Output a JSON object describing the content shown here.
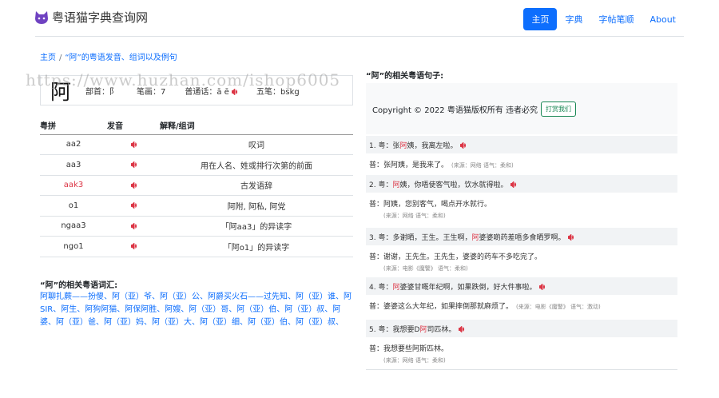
{
  "brand": {
    "name": "粤语猫字典查询网"
  },
  "nav": {
    "items": [
      "主页",
      "字典",
      "字帖笔顺",
      "About"
    ]
  },
  "breadcrumb": {
    "home": "主页",
    "sep": "/",
    "current": "“阿”的粤语发音、组词以及例句"
  },
  "watermark": "https://www.huzhan.com/ishop6005",
  "char": {
    "glyph": "阿",
    "bushou": "部首：阝",
    "bihua": "笔画：7",
    "putonghua": "普通话：ā ē",
    "wubi": "五笔：bskg"
  },
  "pron_table": {
    "headers": [
      "粤拼",
      "发音",
      "解释/组词"
    ],
    "rows": [
      {
        "jyutping": "aa2",
        "meaning": "叹词",
        "red": false
      },
      {
        "jyutping": "aa3",
        "meaning": "用在人名、姓或排行次第的前面",
        "red": false
      },
      {
        "jyutping": "aak3",
        "meaning": "古发语辞",
        "red": true
      },
      {
        "jyutping": "o1",
        "meaning": "阿附, 阿私, 阿党",
        "red": false
      },
      {
        "jyutping": "ngaa3",
        "meaning": "「阿aa3」的异读字",
        "red": false
      },
      {
        "jyutping": "ngo1",
        "meaning": "「阿o1」的异读字",
        "red": false
      }
    ]
  },
  "vocab": {
    "title": "“阿”的相关粤语词汇:",
    "text": "阿聊扎蕨——扮傻、阿（亚）爷、阿（亚）公、阿爵买火石——过先知、阿（亚）谁、阿SIR、阿生、阿狗阿猫、阿保阿胜、阿嫂、阿（亚）哥、阿（亚）伯、阿（亚）叔、阿婆、阿（亚）爸、阿（亚）妈、阿（亚）大、阿（亚）细、阿（亚）伯、阿（亚）叔、"
  },
  "examples": {
    "title": "“阿”的相关粤语句子:",
    "copyright": "Copyright © 2022 粤语猫版权所有 违者必究",
    "donate": "打赏我们",
    "items": [
      {
        "yue_pre": "1. 粤：张",
        "yue_hl": "阿",
        "yue_post": "姨，我离左啦。",
        "pt": "普：张阿姨，是我来了。",
        "src": "(来源：网络  语气：柔和)",
        "src_newline": false
      },
      {
        "yue_pre": "2. 粤：",
        "yue_hl": "阿",
        "yue_post": "姨，你唔使客气啦，饮水就得啦。",
        "pt": "普：阿姨，您别客气，喝点开水就行。",
        "src": "(来源：网络  语气：柔和)",
        "src_newline": true
      },
      {
        "yue_pre": "3. 粤：多谢晒，王生。王生啊，",
        "yue_hl": "阿",
        "yue_post": "婆婆啲药差唔多食晒罗啊。",
        "pt": "普：谢谢，王先生。王先生，婆婆的药车不多吃完了。",
        "src": "(来源：电影《魔警》  语气：柔和)",
        "src_newline": true
      },
      {
        "yue_pre": "4. 粤：",
        "yue_hl": "阿",
        "yue_post": "婆婆甘嘅年纪啊，如果跌倒，好大件事啦。",
        "pt": "普：婆婆这么大年纪，如果摔倒那就麻烦了。",
        "src": "(来源：电影《魔警》  语气：激动)",
        "src_newline": false
      },
      {
        "yue_pre": "5. 粤：我想要D",
        "yue_hl": "阿",
        "yue_post": "司匹林。",
        "pt": "普：我想要些阿斯匹林。",
        "src": "(来源：网络  语气：柔和)",
        "src_newline": true
      }
    ]
  },
  "colors": {
    "primary": "#0d6efd",
    "red": "#dc3545",
    "success": "#198754"
  }
}
